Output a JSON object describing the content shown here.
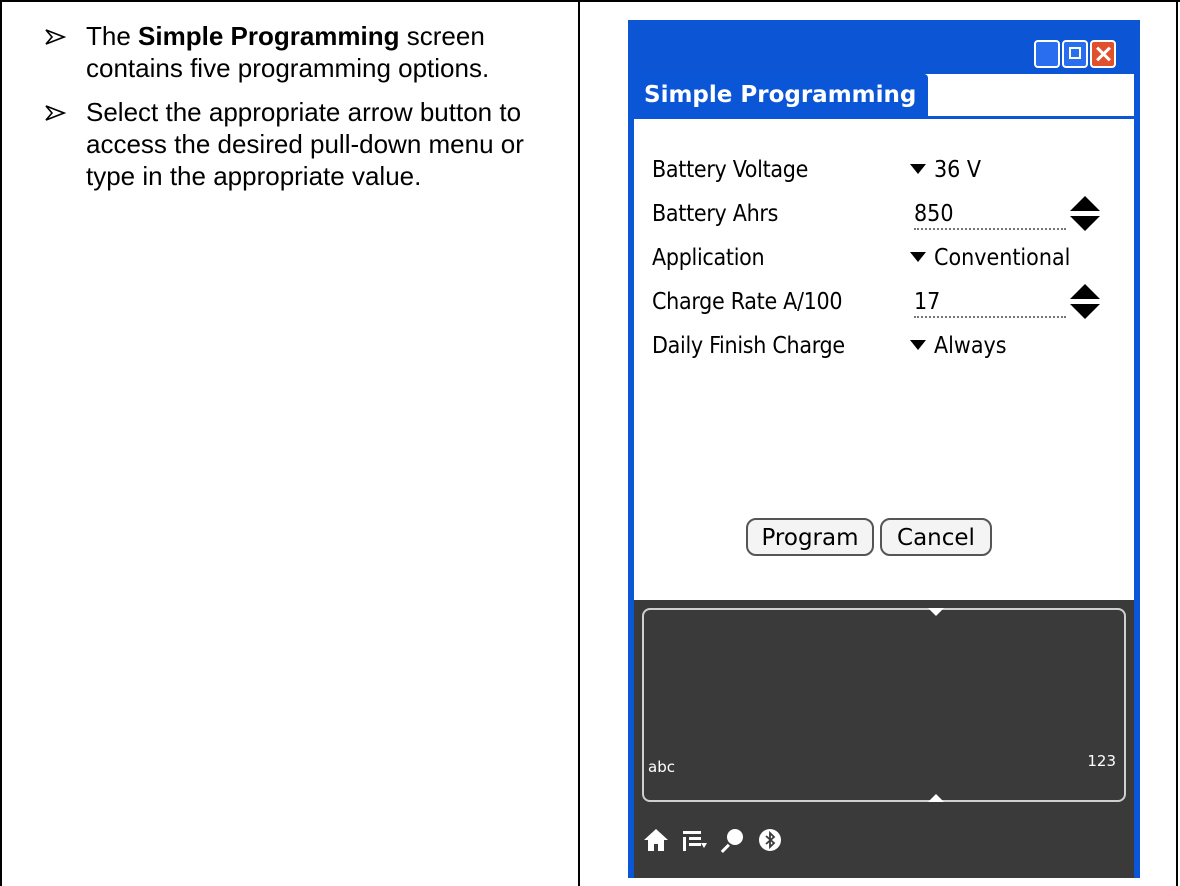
{
  "left_column": {
    "bullet1": {
      "prefix": "The ",
      "bold": "Simple Programming",
      "suffix": " screen contains five programming options."
    },
    "bullet2": {
      "text": "Select the appropriate arrow button to access the desired pull-down menu or type in the appropriate value."
    }
  },
  "device": {
    "form_title": "Simple Programming",
    "fields": {
      "battery_voltage": {
        "label": "Battery Voltage",
        "value": "36 V"
      },
      "battery_ahrs": {
        "label": "Battery Ahrs",
        "value": "850"
      },
      "application": {
        "label": "Application",
        "value": "Conventional"
      },
      "charge_rate": {
        "label": "Charge Rate A/100",
        "value": "17"
      },
      "daily_finish": {
        "label": "Daily Finish Charge",
        "value": "Always"
      }
    },
    "buttons": {
      "program": "Program",
      "cancel": "Cancel"
    },
    "graffiti": {
      "left_hint": "abc",
      "right_hint": "123"
    },
    "dock_icons": [
      "home-icon",
      "menu-icon",
      "find-icon",
      "bluetooth-icon"
    ]
  },
  "colors": {
    "palm_blue": "#0a56d6",
    "graffiti_bg": "#3a3a3a",
    "close_red": "#e0502c"
  }
}
